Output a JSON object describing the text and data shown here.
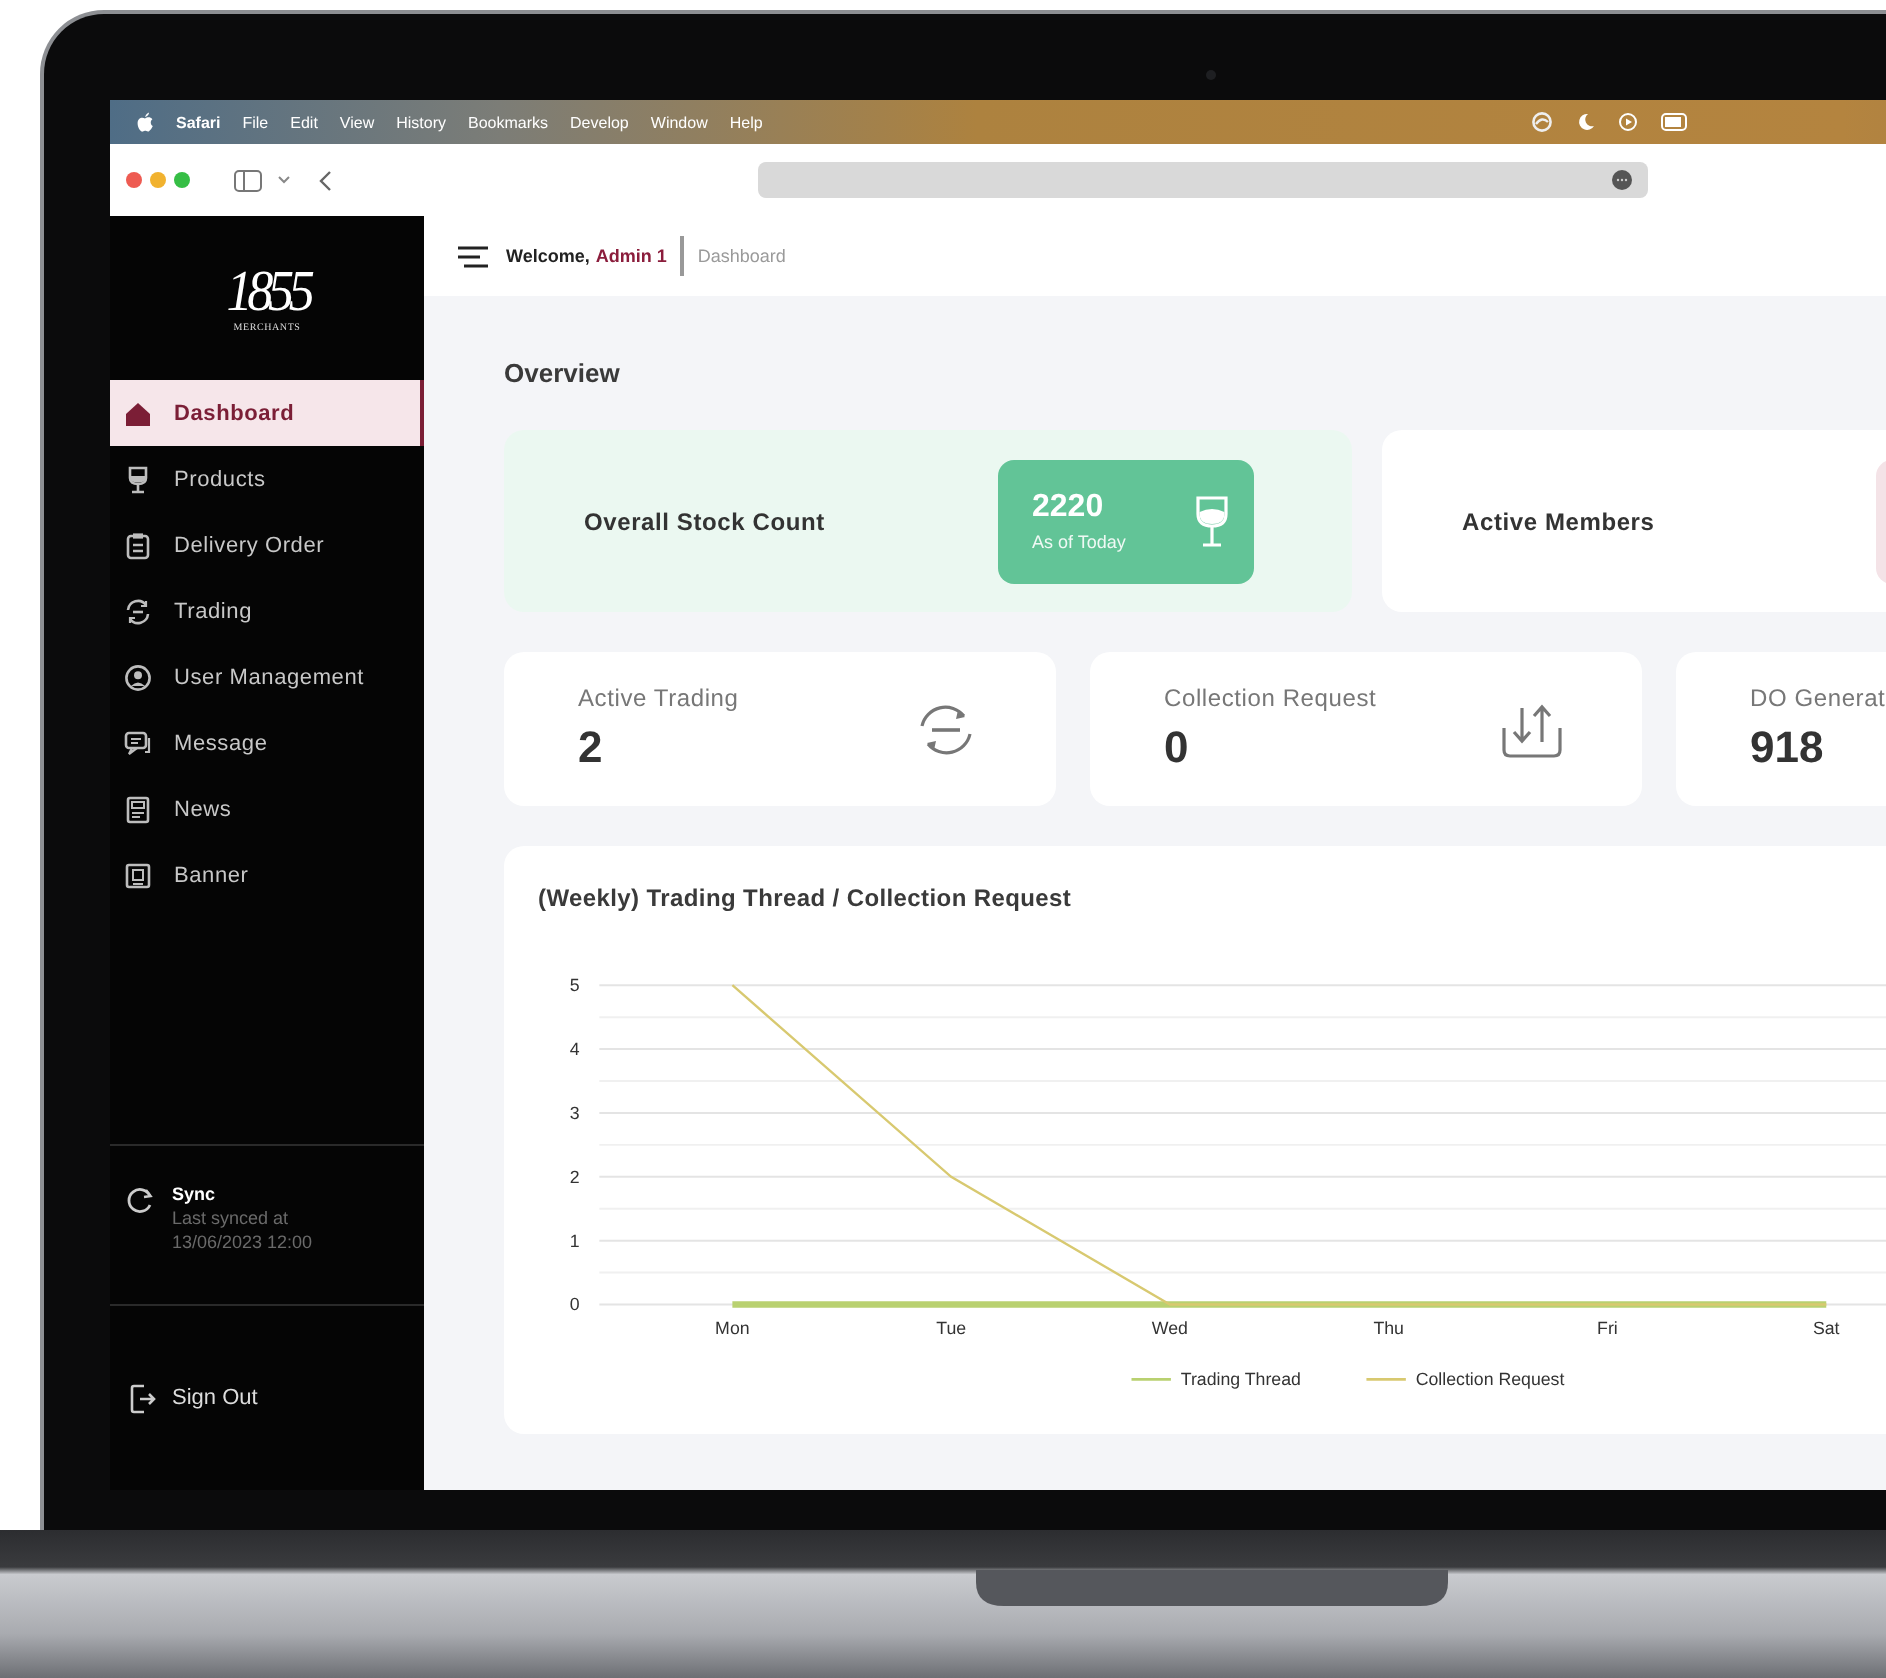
{
  "menu_bar": {
    "app": "Safari",
    "items": [
      "File",
      "Edit",
      "View",
      "History",
      "Bookmarks",
      "Develop",
      "Window",
      "Help"
    ]
  },
  "sidebar": {
    "logo": {
      "mark": "1855",
      "subtitle": "MERCHANTS"
    },
    "items": [
      {
        "label": "Dashboard",
        "selected": true
      },
      {
        "label": "Products",
        "selected": false
      },
      {
        "label": "Delivery Order",
        "selected": false
      },
      {
        "label": "Trading",
        "selected": false
      },
      {
        "label": "User Management",
        "selected": false
      },
      {
        "label": "Message",
        "selected": false
      },
      {
        "label": "News",
        "selected": false
      },
      {
        "label": "Banner",
        "selected": false
      }
    ],
    "sync": {
      "title": "Sync",
      "subtitle": "Last synced at",
      "time": "13/06/2023 12:00"
    },
    "sign_out": "Sign Out"
  },
  "header": {
    "greeting": "Welcome,",
    "user": "Admin 1",
    "breadcrumb": "Dashboard"
  },
  "overview": {
    "title": "Overview",
    "highlights": [
      {
        "label": "Overall Stock Count",
        "value": "2220",
        "note": "As of Today",
        "color": "#62c497"
      },
      {
        "label": "Active Members",
        "color": "#f4e3e7"
      }
    ],
    "stats": [
      {
        "label": "Active Trading",
        "value": "2"
      },
      {
        "label": "Collection Request",
        "value": "0"
      },
      {
        "label": "DO Generat",
        "value": "918"
      }
    ]
  },
  "chart": {
    "chart_data": {
      "type": "line",
      "title": "(Weekly) Trading Thread / Collection Request",
      "categories": [
        "Mon",
        "Tue",
        "Wed",
        "Thu",
        "Fri",
        "Sat"
      ],
      "series": [
        {
          "name": "Trading Thread",
          "color": "#b9d170",
          "values": [
            0,
            0,
            0,
            0,
            0,
            0
          ]
        },
        {
          "name": "Collection Request",
          "color": "#d8c970",
          "values": [
            5,
            2,
            0,
            0,
            0,
            0
          ]
        }
      ],
      "ylim": [
        0,
        5
      ],
      "yticks": [
        0,
        1,
        2,
        3,
        4,
        5
      ],
      "grid": true,
      "legend": true
    }
  }
}
